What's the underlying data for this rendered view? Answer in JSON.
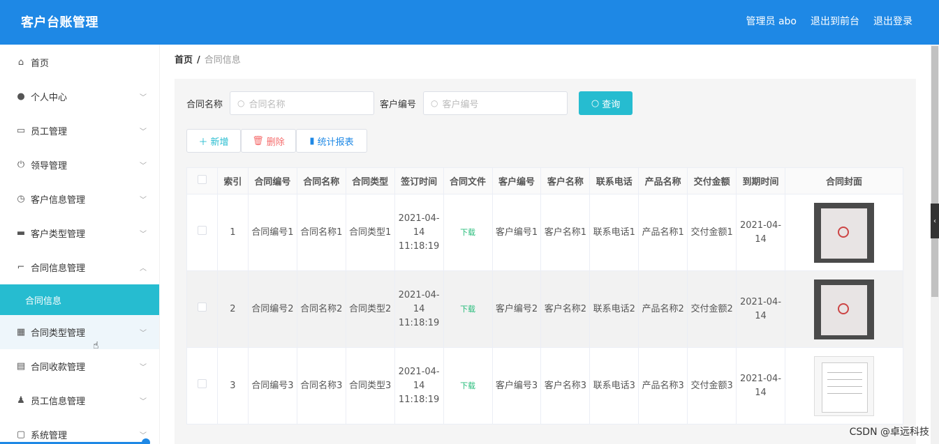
{
  "header": {
    "title": "客户台账管理",
    "admin": "管理员 abo",
    "back_front": "退出到前台",
    "logout": "退出登录"
  },
  "sidebar": {
    "items": [
      {
        "label": "首页",
        "icon": "home-icon"
      },
      {
        "label": "个人中心",
        "icon": "user-icon"
      },
      {
        "label": "员工管理",
        "icon": "id-card-icon"
      },
      {
        "label": "领导管理",
        "icon": "power-icon"
      },
      {
        "label": "客户信息管理",
        "icon": "clock-icon"
      },
      {
        "label": "客户类型管理",
        "icon": "briefcase-icon"
      },
      {
        "label": "合同信息管理",
        "icon": "crop-icon"
      },
      {
        "label": "合同类型管理",
        "icon": "grid-icon"
      },
      {
        "label": "合同收款管理",
        "icon": "clipboard-icon"
      },
      {
        "label": "员工信息管理",
        "icon": "person-icon"
      },
      {
        "label": "系统管理",
        "icon": "chat-icon"
      }
    ],
    "sub_active": "合同信息"
  },
  "breadcrumb": {
    "home": "首页",
    "sep": "/",
    "current": "合同信息"
  },
  "search": {
    "label1": "合同名称",
    "placeholder1": "合同名称",
    "label2": "客户编号",
    "placeholder2": "客户编号",
    "button": "查询"
  },
  "actions": {
    "add": "新增",
    "delete": "删除",
    "stats": "统计报表"
  },
  "table": {
    "headers": [
      "索引",
      "合同编号",
      "合同名称",
      "合同类型",
      "签订时间",
      "合同文件",
      "客户编号",
      "客户名称",
      "联系电话",
      "产品名称",
      "交付金额",
      "到期时间",
      "合同封面"
    ],
    "rows": [
      {
        "index": "1",
        "contract_no": "合同编号1",
        "contract_name": "合同名称1",
        "contract_type": "合同类型1",
        "sign_time": "2021-04-14 11:18:19",
        "file": "下载",
        "customer_no": "客户编号1",
        "customer_name": "客户名称1",
        "phone": "联系电话1",
        "product": "产品名称1",
        "amount": "交付金额1",
        "expire": "2021-04-14"
      },
      {
        "index": "2",
        "contract_no": "合同编号2",
        "contract_name": "合同名称2",
        "contract_type": "合同类型2",
        "sign_time": "2021-04-14 11:18:19",
        "file": "下载",
        "customer_no": "客户编号2",
        "customer_name": "客户名称2",
        "phone": "联系电话2",
        "product": "产品名称2",
        "amount": "交付金额2",
        "expire": "2021-04-14"
      },
      {
        "index": "3",
        "contract_no": "合同编号3",
        "contract_name": "合同名称3",
        "contract_type": "合同类型3",
        "sign_time": "2021-04-14 11:18:19",
        "file": "下载",
        "customer_no": "客户编号3",
        "customer_name": "客户名称3",
        "phone": "联系电话3",
        "product": "产品名称3",
        "amount": "交付金额3",
        "expire": "2021-04-14"
      }
    ]
  },
  "watermark": "CSDN @卓远科技",
  "colors": {
    "primary": "#1e88e5",
    "accent": "#26bcd0",
    "danger": "#f56c6c",
    "download": "#26bc7a"
  }
}
